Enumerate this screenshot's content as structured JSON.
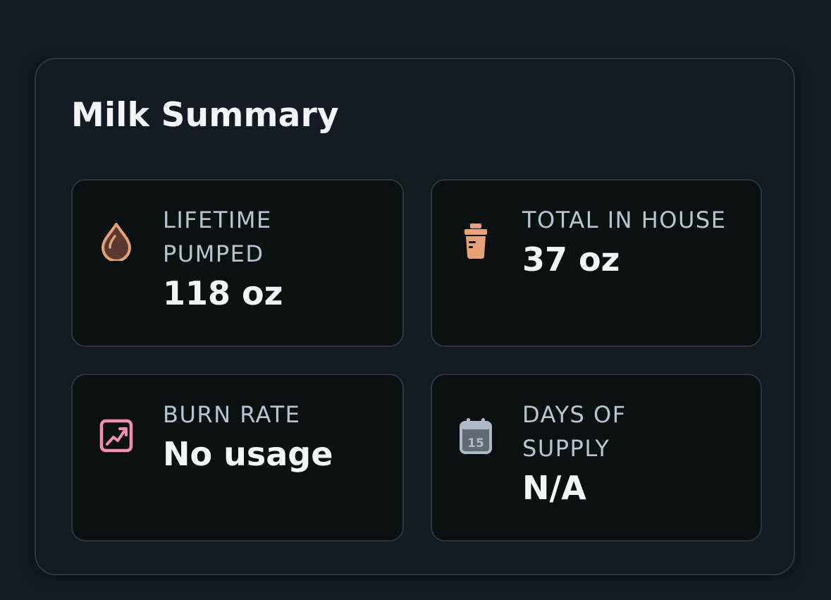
{
  "summary": {
    "title": "Milk Summary",
    "stats": [
      {
        "label": "LIFETIME PUMPED",
        "value": "118 oz",
        "icon": "drop-icon",
        "color": "#e8a077"
      },
      {
        "label": "TOTAL IN HOUSE",
        "value": "37 oz",
        "icon": "milk-jar-icon",
        "color": "#e8a077"
      },
      {
        "label": "BURN RATE",
        "value": "No usage",
        "icon": "trend-chart-icon",
        "color": "#f08fb3"
      },
      {
        "label": "DAYS OF SUPPLY",
        "value": "N/A",
        "icon": "calendar-icon",
        "color": "#aebbc6",
        "icon_text": "15"
      }
    ]
  }
}
